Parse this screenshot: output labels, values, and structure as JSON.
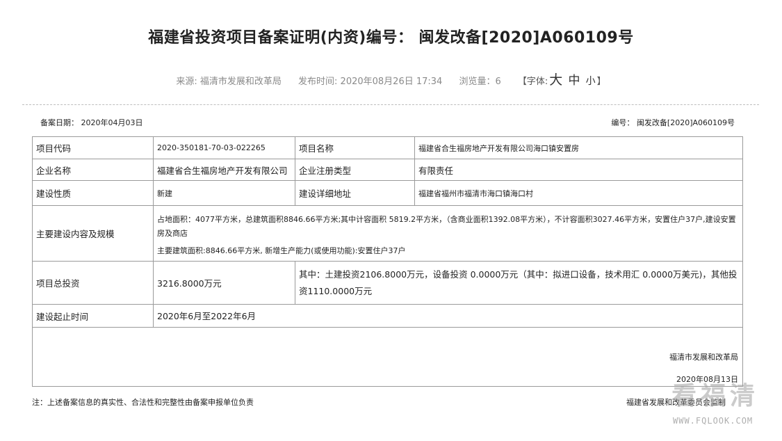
{
  "title": "福建省投资项目备案证明(内资)编号： 闽发改备[2020]A060109号",
  "meta": {
    "source": "来源: 福清市发展和改革局",
    "publish_time": "发布时间: 2020年08月26日 17:34",
    "views": "浏览量：6",
    "font_label_open": "【字体:",
    "font_big": "大",
    "font_mid": "中",
    "font_small": "小",
    "font_label_close": "】"
  },
  "record": {
    "date": "备案日期： 2020年04月03日",
    "number": "编号： 闽发改备[2020]A060109号"
  },
  "table": {
    "project_code_label": "项目代码",
    "project_code": "2020-350181-70-03-022265",
    "project_name_label": "项目名称",
    "project_name": "福建省合生福房地产开发有限公司海口镇安置房",
    "company_label": "企业名称",
    "company": "福建省合生福房地产开发有限公司",
    "reg_type_label": "企业注册类型",
    "reg_type": "有限责任",
    "nature_label": "建设性质",
    "nature": "新建",
    "address_label": "建设详细地址",
    "address": "福建省福州市福清市海口镇海口村",
    "scale_label": "主要建设内容及规模",
    "scale_text1": "占地面积：4077平方米，总建筑面积8846.66平方米;其中计容面积 5819.2平方米，（含商业面积1392.08平方米），不计容面积3027.46平方米，安置住户37户,建设安置房及商店",
    "scale_text2": "主要建筑面积:8846.66平方米, 新增生产能力(或使用功能):安置住户37户",
    "investment_label": "项目总投资",
    "investment": "3216.8000万元",
    "investment_detail": "其中：土建投资2106.8000万元，设备投资 0.0000万元（其中：拟进口设备，技术用汇 0.0000万美元)，其他投资1110.0000万元",
    "period_label": "建设起止时间",
    "period": "2020年6月至2022年6月",
    "sign_org": "福清市发展和改革局",
    "sign_date": "2020年08月13日"
  },
  "footer": {
    "note": "注：上述备案信息的真实性、合法性和完整性由备案申报单位负责",
    "supervisor": "福建省发展和改革委员会监制"
  },
  "watermark": {
    "text": "看福清",
    "url": "WWW.FQLOOK.COM"
  }
}
